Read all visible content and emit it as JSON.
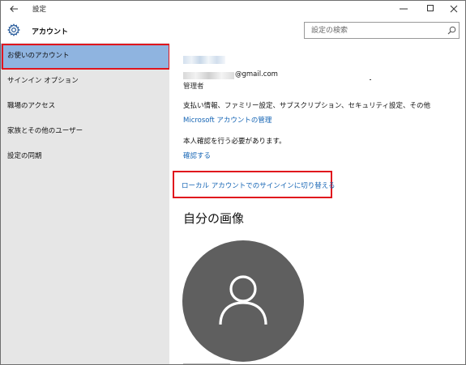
{
  "window": {
    "app_title": "設定",
    "back_icon": "arrow-left-icon",
    "minimize_icon": "minimize-icon",
    "maximize_icon": "maximize-icon",
    "close_icon": "close-icon"
  },
  "header": {
    "icon": "gear-icon",
    "title": "アカウント",
    "search_placeholder": "設定の検索",
    "search_icon": "search-icon"
  },
  "sidebar": {
    "items": [
      {
        "label": "お使いのアカウント",
        "selected": true
      },
      {
        "label": "サインイン オプション",
        "selected": false
      },
      {
        "label": "職場のアクセス",
        "selected": false
      },
      {
        "label": "家族とその他のユーザー",
        "selected": false
      },
      {
        "label": "設定の同期",
        "selected": false
      }
    ]
  },
  "account": {
    "email_suffix": "@gmail.com",
    "role": "管理者",
    "info_text": "支払い情報、ファミリー設定、サブスクリプション、セキュリティ設定、その他",
    "manage_link": "Microsoft アカウントの管理",
    "verify_text": "本人確認を行う必要があります。",
    "verify_link": "確認する",
    "local_switch_link": "ローカル アカウントでのサインインに切り替える"
  },
  "picture": {
    "heading": "自分の画像",
    "avatar_icon": "user-icon"
  },
  "colors": {
    "selected_bg": "#8fb4e0",
    "highlight_border": "#e0151d",
    "link": "#1464b4",
    "sidebar_bg": "#e6e6e6",
    "avatar_bg": "#5f5f5f"
  }
}
